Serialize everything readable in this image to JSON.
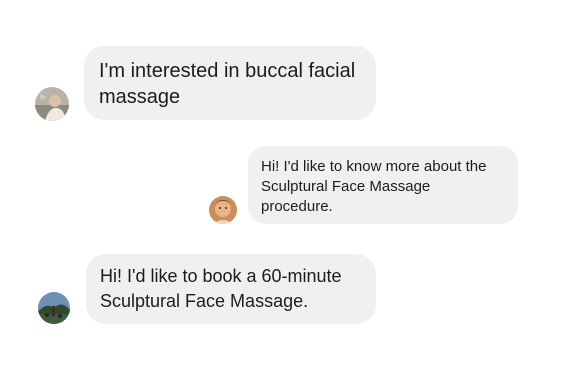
{
  "messages": [
    {
      "avatar_icon": "user-avatar-photo",
      "text": "I'm interested in buccal facial\nmassage"
    },
    {
      "avatar_icon": "user-avatar-photo",
      "text": "Hi! I'd like to know more about the\nSculptural Face Massage\nprocedure."
    },
    {
      "avatar_icon": "user-avatar-photo",
      "text": "Hi! I'd like to book a 60-minute\nSculptural Face Massage."
    }
  ],
  "colors": {
    "bubble_background": "#f0f0f2",
    "text": "#1c1c1e",
    "page_background": "#ffffff"
  }
}
